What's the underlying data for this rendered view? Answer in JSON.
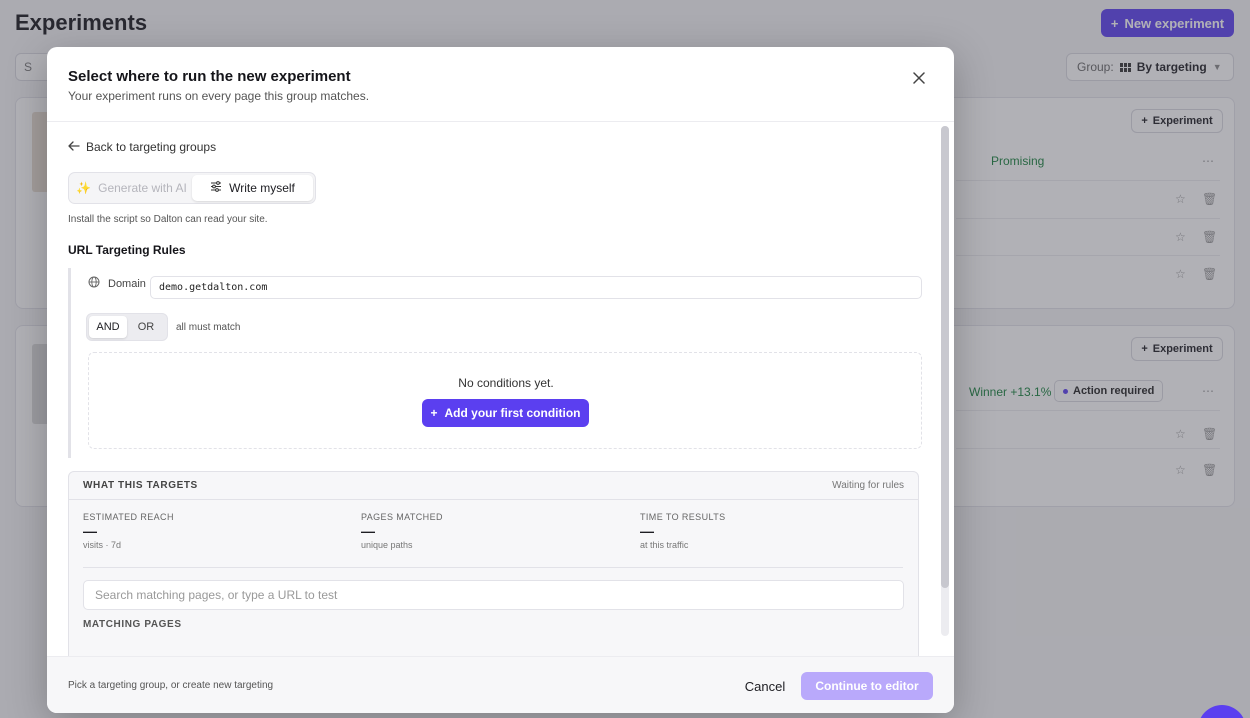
{
  "background": {
    "title": "Experiments",
    "new_experiment_label": "New experiment",
    "search_initial": "S",
    "group_label": "Group:",
    "group_value": "By targeting",
    "cards": [
      {
        "experiment_label": "Experiment",
        "status": "Promising"
      },
      {
        "experiment_label": "Experiment",
        "status": "Winner +13.1%",
        "badge": "Action required"
      }
    ]
  },
  "modal": {
    "title": "Select where to run the new experiment",
    "subtitle": "Your experiment runs on every page this group matches.",
    "back_label": "Back to targeting groups",
    "mode_ai_label": "Generate with AI",
    "mode_manual_label": "Write myself",
    "install_note": "Install the script so Dalton can read your site.",
    "rules_title": "URL Targeting Rules",
    "domain_label": "Domain",
    "domain_value": "demo.getdalton.com",
    "logic_and": "AND",
    "logic_or": "OR",
    "logic_note": "all must match",
    "empty_text": "No conditions yet.",
    "add_condition_label": "Add your first condition",
    "targets": {
      "title": "WHAT THIS TARGETS",
      "status": "Waiting for rules",
      "stats": [
        {
          "label": "ESTIMATED REACH",
          "value": "—",
          "sub": "visits · 7d"
        },
        {
          "label": "PAGES MATCHED",
          "value": "—",
          "sub": "unique paths"
        },
        {
          "label": "TIME TO RESULTS",
          "value": "—",
          "sub": "at this traffic"
        }
      ],
      "search_placeholder": "Search matching pages, or type a URL to test",
      "matching_title": "MATCHING PAGES"
    },
    "footer_note": "Pick a targeting group, or create new targeting",
    "cancel_label": "Cancel",
    "continue_label": "Continue to editor"
  },
  "colors": {
    "accent": "#5b3ff0",
    "accent_disabled": "#b9a9fb",
    "success": "#16813b"
  }
}
